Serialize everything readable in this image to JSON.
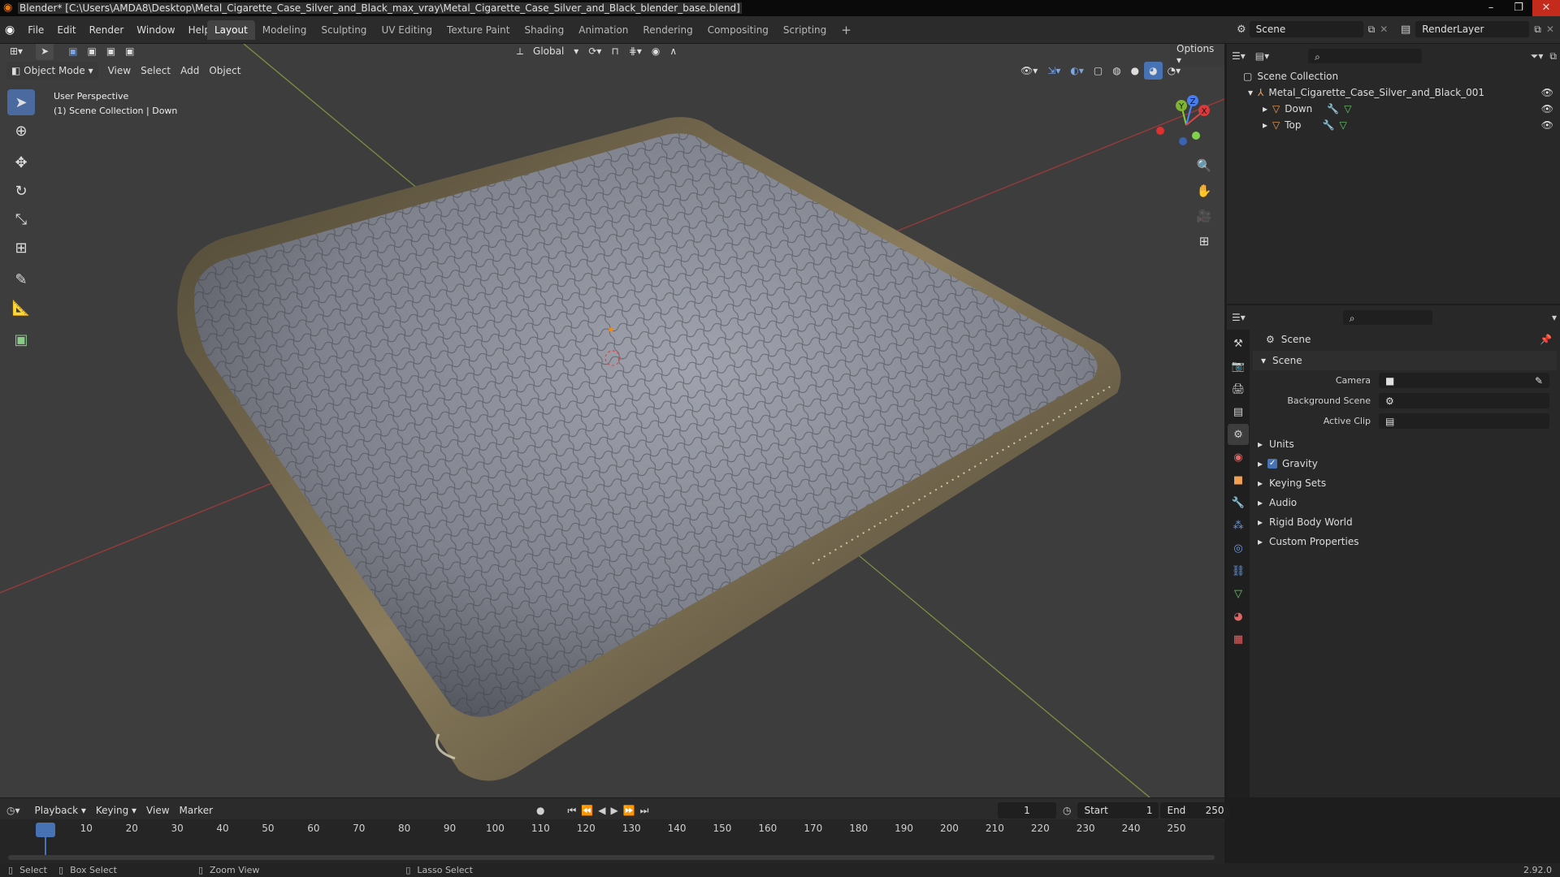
{
  "titlebar": {
    "text": "Blender* [C:\\Users\\AMDA8\\Desktop\\Metal_Cigarette_Case_Silver_and_Black_max_vray\\Metal_Cigarette_Case_Silver_and_Black_blender_base.blend]",
    "min_icon": "minimize-icon",
    "max_icon": "maximize-icon",
    "close_icon": "close-icon"
  },
  "menu": [
    "File",
    "Edit",
    "Render",
    "Window",
    "Help"
  ],
  "workspaces": [
    "Layout",
    "Modeling",
    "Sculpting",
    "UV Editing",
    "Texture Paint",
    "Shading",
    "Animation",
    "Rendering",
    "Compositing",
    "Scripting"
  ],
  "active_workspace": "Layout",
  "scene_field": "Scene",
  "renderlayer_field": "RenderLayer",
  "viewport_header": {
    "transform_orientation": "Global",
    "options": "Options",
    "mode": "Object Mode",
    "menus": [
      "View",
      "Select",
      "Add",
      "Object"
    ]
  },
  "viewport_overlay": {
    "line1": "User Perspective",
    "line2": "(1) Scene Collection | Down"
  },
  "gizmo": {
    "x": "X",
    "y": "Y",
    "z": "Z"
  },
  "outliner": {
    "root": "Scene Collection",
    "collection": "Metal_Cigarette_Case_Silver_and_Black_001",
    "children": [
      "Down",
      "Top"
    ]
  },
  "properties": {
    "header": "Scene",
    "panel": "Scene",
    "fields": [
      {
        "label": "Camera"
      },
      {
        "label": "Background Scene"
      },
      {
        "label": "Active Clip"
      }
    ],
    "sections": [
      "Units",
      "Gravity",
      "Keying Sets",
      "Audio",
      "Rigid Body World",
      "Custom Properties"
    ],
    "gravity_checked": true
  },
  "timeline": {
    "menus": [
      "Playback",
      "Keying",
      "View",
      "Marker"
    ],
    "current_frame": "1",
    "start_label": "Start",
    "start": "1",
    "end_label": "End",
    "end": "250",
    "ticks": [
      "1",
      "10",
      "20",
      "30",
      "40",
      "50",
      "60",
      "70",
      "80",
      "90",
      "100",
      "110",
      "120",
      "130",
      "140",
      "150",
      "160",
      "170",
      "180",
      "190",
      "200",
      "210",
      "220",
      "230",
      "240",
      "250"
    ]
  },
  "statusbar": {
    "select": "Select",
    "box_select": "Box Select",
    "zoom_view": "Zoom View",
    "lasso_select": "Lasso Select",
    "version": "2.92.0"
  },
  "colors": {
    "accent": "#4772b3",
    "viewport_bg": "#3d3d3d",
    "axis_x": "#c23a3a",
    "axis_y": "#7fa52e"
  }
}
